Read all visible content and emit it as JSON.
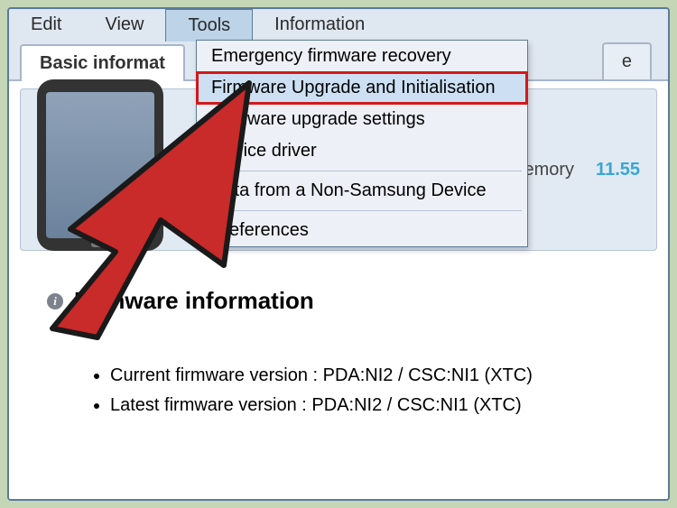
{
  "menubar": {
    "edit": "Edit",
    "view": "View",
    "tools": "Tools",
    "information": "Information"
  },
  "tabs": {
    "basic_info": "Basic informat",
    "partial_right": "e"
  },
  "tools_menu": {
    "items": [
      "Emergency firmware recovery",
      "Firmware Upgrade and Initialisation",
      "Firmware upgrade settings",
      "Device driver",
      "Data from a Non-Samsung Device",
      "Preferences"
    ]
  },
  "device": {
    "mem_label": "al memory",
    "mem_value": "11.55"
  },
  "firmware": {
    "heading": "Firmware information",
    "current": "Current firmware version : PDA:NI2 / CSC:NI1 (XTC)",
    "latest": "Latest firmware version : PDA:NI2 / CSC:NI1 (XTC)"
  }
}
